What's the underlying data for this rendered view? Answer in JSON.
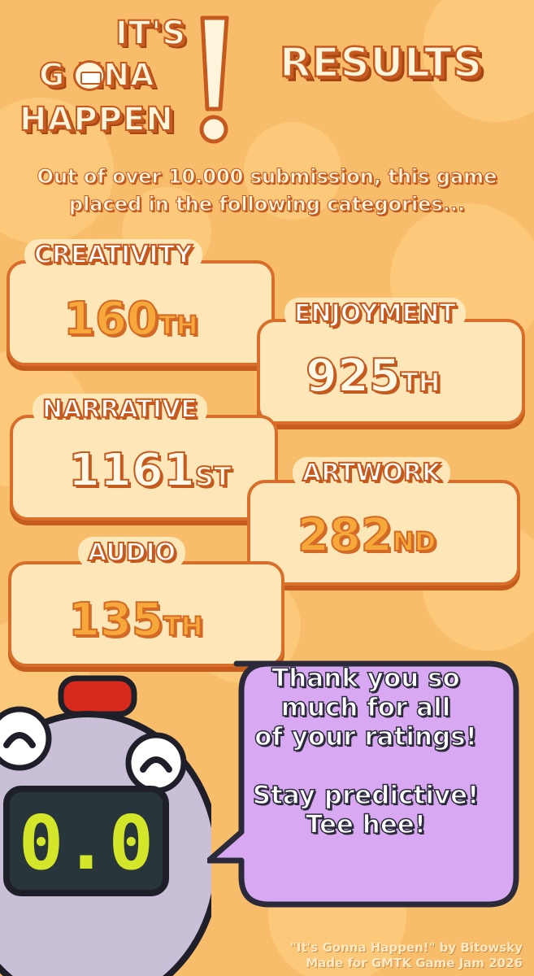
{
  "logo": {
    "line1": "IT'S",
    "line2": "G  NNA",
    "line3": "HAPPEN"
  },
  "title": "RESULTS",
  "intro": {
    "line1": "Out of over 10.000 submission, this game",
    "line2": "placed in the following categories..."
  },
  "categories": [
    {
      "name": "CREATIVITY",
      "rank": "160",
      "suffix": "TH"
    },
    {
      "name": "ENJOYMENT",
      "rank": "925",
      "suffix": "TH"
    },
    {
      "name": "NARRATIVE",
      "rank": "1161",
      "suffix": "ST"
    },
    {
      "name": "ARTWORK",
      "rank": "282",
      "suffix": "ND"
    },
    {
      "name": "AUDIO",
      "rank": "135",
      "suffix": "TH"
    }
  ],
  "mascot": {
    "display": "0.0"
  },
  "bubble": {
    "line1": "Thank you so",
    "line2": "much for all",
    "line3": "of your ratings!",
    "line4": "Stay predictive!",
    "line5": "Tee hee!"
  },
  "credits": {
    "line1": "\"It's Gonna Happen!\" by Bitowsky",
    "line2": "Made for GMTK Game Jam 2026"
  },
  "colors": {
    "background": "#f7bd6b",
    "card": "#fde7b8",
    "card_border": "#d86e2a",
    "rank_orange": "#f6a83a",
    "bubble": "#d9a8f2",
    "display_text": "#d4e62a"
  }
}
